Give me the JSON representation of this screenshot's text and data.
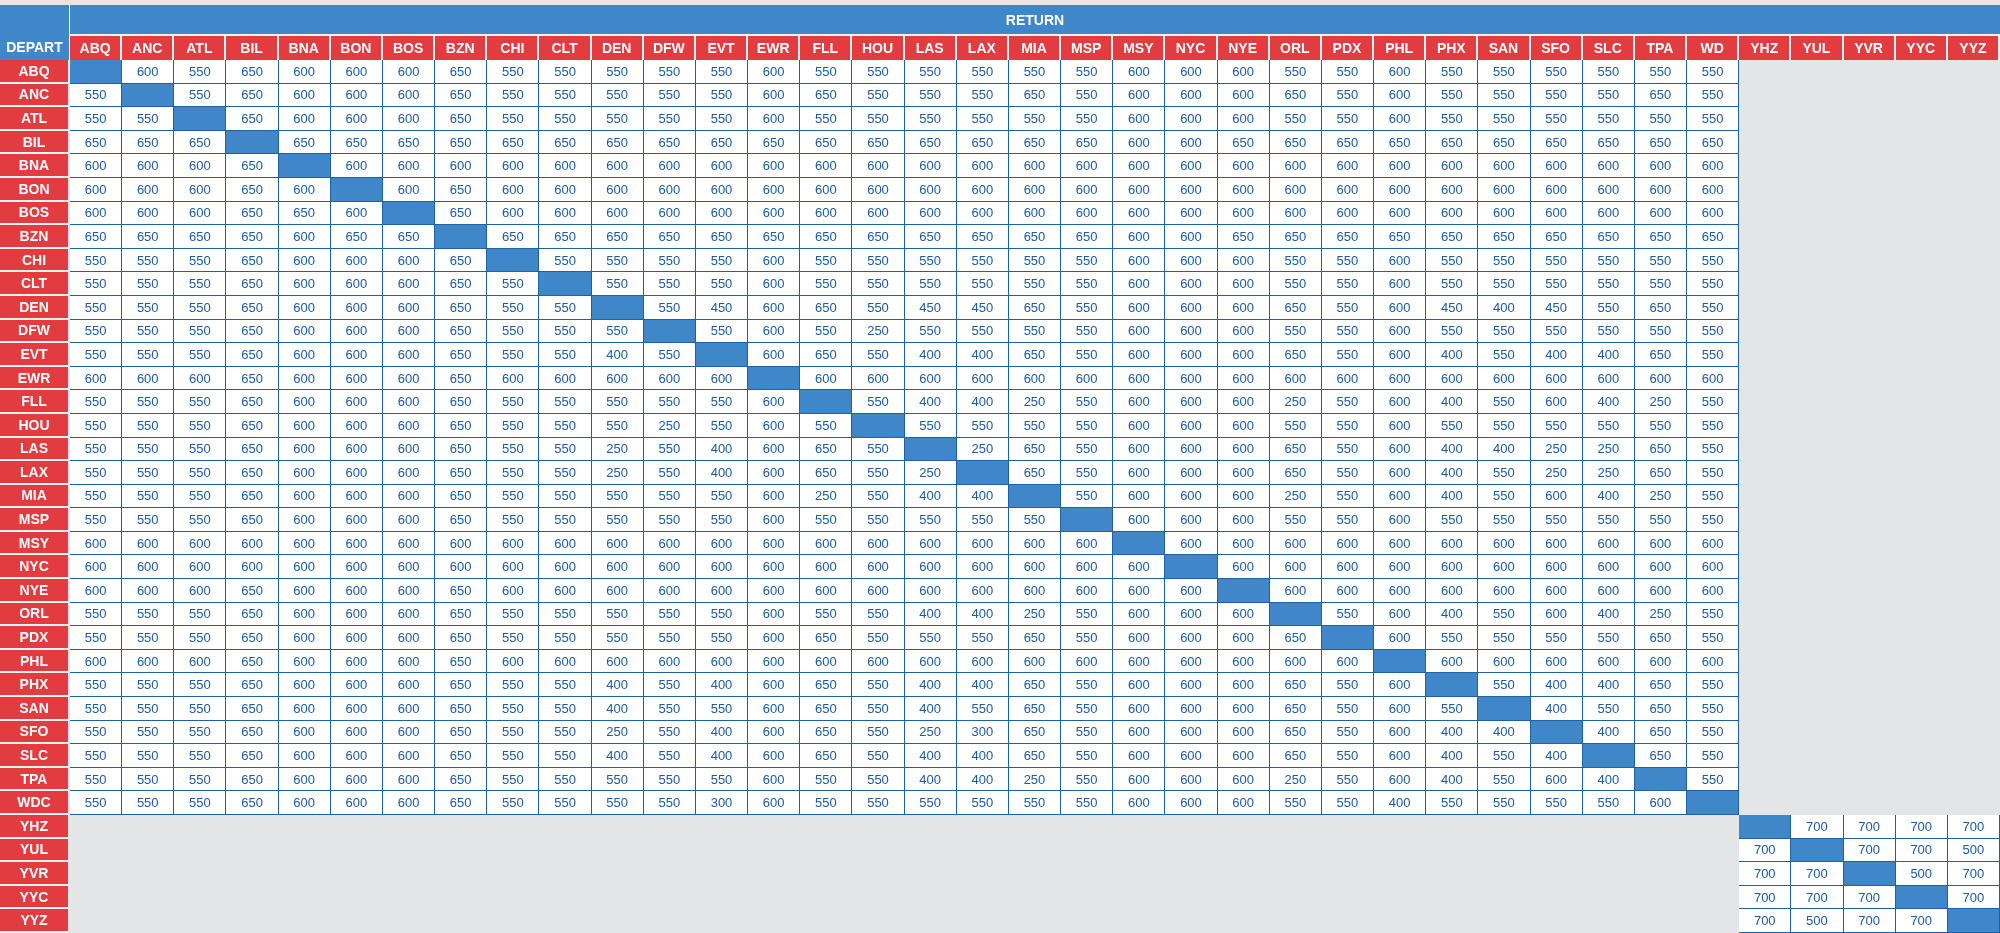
{
  "header": {
    "return_label": "RETURN",
    "depart_label": "DEPART"
  },
  "columns": [
    "ABQ",
    "ANC",
    "ATL",
    "BIL",
    "BNA",
    "BON",
    "BOS",
    "BZN",
    "CHI",
    "CLT",
    "DEN",
    "DFW",
    "EVT",
    "EWR",
    "FLL",
    "HOU",
    "LAS",
    "LAX",
    "MIA",
    "MSP",
    "MSY",
    "NYC",
    "NYE",
    "ORL",
    "PDX",
    "PHL",
    "PHX",
    "SAN",
    "SFO",
    "SLC",
    "TPA",
    "WD",
    "YHZ",
    "YUL",
    "YVR",
    "YYC",
    "YYZ"
  ],
  "rows": [
    {
      "code": "ABQ",
      "kind": "lead",
      "cells": [
        null,
        "600",
        "550",
        "650",
        "600",
        "600",
        "600",
        "650",
        "550",
        "550",
        "550",
        "550",
        "550",
        "600",
        "550",
        "550",
        "550",
        "550",
        "550",
        "550",
        "600",
        "600",
        "600",
        "550",
        "550",
        "600",
        "550",
        "550",
        "550",
        "550",
        "550",
        "550"
      ]
    },
    {
      "code": "ANC",
      "kind": "lead",
      "cells": [
        "550",
        null,
        "550",
        "650",
        "600",
        "600",
        "600",
        "650",
        "550",
        "550",
        "550",
        "550",
        "550",
        "600",
        "650",
        "550",
        "550",
        "550",
        "650",
        "550",
        "600",
        "600",
        "600",
        "650",
        "550",
        "600",
        "550",
        "550",
        "550",
        "550",
        "650",
        "550"
      ]
    },
    {
      "code": "ATL",
      "kind": "lead",
      "cells": [
        "550",
        "550",
        null,
        "650",
        "600",
        "600",
        "600",
        "650",
        "550",
        "550",
        "550",
        "550",
        "550",
        "600",
        "550",
        "550",
        "550",
        "550",
        "550",
        "550",
        "600",
        "600",
        "600",
        "550",
        "550",
        "600",
        "550",
        "550",
        "550",
        "550",
        "550",
        "550"
      ]
    },
    {
      "code": "BIL",
      "kind": "lead",
      "cells": [
        "650",
        "650",
        "650",
        null,
        "650",
        "650",
        "650",
        "650",
        "650",
        "650",
        "650",
        "650",
        "650",
        "650",
        "650",
        "650",
        "650",
        "650",
        "650",
        "650",
        "600",
        "600",
        "650",
        "650",
        "650",
        "650",
        "650",
        "650",
        "650",
        "650",
        "650",
        "650"
      ]
    },
    {
      "code": "BNA",
      "kind": "lead",
      "cells": [
        "600",
        "600",
        "600",
        "650",
        null,
        "600",
        "600",
        "600",
        "600",
        "600",
        "600",
        "600",
        "600",
        "600",
        "600",
        "600",
        "600",
        "600",
        "600",
        "600",
        "600",
        "600",
        "600",
        "600",
        "600",
        "600",
        "600",
        "600",
        "600",
        "600",
        "600",
        "600"
      ]
    },
    {
      "code": "BON",
      "kind": "lead",
      "cells": [
        "600",
        "600",
        "600",
        "650",
        "600",
        null,
        "600",
        "650",
        "600",
        "600",
        "600",
        "600",
        "600",
        "600",
        "600",
        "600",
        "600",
        "600",
        "600",
        "600",
        "600",
        "600",
        "600",
        "600",
        "600",
        "600",
        "600",
        "600",
        "600",
        "600",
        "600",
        "600"
      ]
    },
    {
      "code": "BOS",
      "kind": "lead",
      "cells": [
        "600",
        "600",
        "600",
        "650",
        "650",
        "600",
        null,
        "650",
        "600",
        "600",
        "600",
        "600",
        "600",
        "600",
        "600",
        "600",
        "600",
        "600",
        "600",
        "600",
        "600",
        "600",
        "600",
        "600",
        "600",
        "600",
        "600",
        "600",
        "600",
        "600",
        "600",
        "600"
      ]
    },
    {
      "code": "BZN",
      "kind": "lead",
      "cells": [
        "650",
        "650",
        "650",
        "650",
        "600",
        "650",
        "650",
        null,
        "650",
        "650",
        "650",
        "650",
        "650",
        "650",
        "650",
        "650",
        "650",
        "650",
        "650",
        "650",
        "600",
        "600",
        "650",
        "650",
        "650",
        "650",
        "650",
        "650",
        "650",
        "650",
        "650",
        "650"
      ]
    },
    {
      "code": "CHI",
      "kind": "lead",
      "cells": [
        "550",
        "550",
        "550",
        "650",
        "600",
        "600",
        "600",
        "650",
        null,
        "550",
        "550",
        "550",
        "550",
        "600",
        "550",
        "550",
        "550",
        "550",
        "550",
        "550",
        "600",
        "600",
        "600",
        "550",
        "550",
        "600",
        "550",
        "550",
        "550",
        "550",
        "550",
        "550"
      ]
    },
    {
      "code": "CLT",
      "kind": "lead",
      "cells": [
        "550",
        "550",
        "550",
        "650",
        "600",
        "600",
        "600",
        "650",
        "550",
        null,
        "550",
        "550",
        "550",
        "600",
        "550",
        "550",
        "550",
        "550",
        "550",
        "550",
        "600",
        "600",
        "600",
        "550",
        "550",
        "600",
        "550",
        "550",
        "550",
        "550",
        "550",
        "550"
      ]
    },
    {
      "code": "DEN",
      "kind": "lead",
      "cells": [
        "550",
        "550",
        "550",
        "650",
        "600",
        "600",
        "600",
        "650",
        "550",
        "550",
        null,
        "550",
        "450",
        "600",
        "650",
        "550",
        "450",
        "450",
        "650",
        "550",
        "600",
        "600",
        "600",
        "650",
        "550",
        "600",
        "450",
        "400",
        "450",
        "550",
        "650",
        "550"
      ]
    },
    {
      "code": "DFW",
      "kind": "lead",
      "cells": [
        "550",
        "550",
        "550",
        "650",
        "600",
        "600",
        "600",
        "650",
        "550",
        "550",
        "550",
        null,
        "550",
        "600",
        "550",
        "250",
        "550",
        "550",
        "550",
        "550",
        "600",
        "600",
        "600",
        "550",
        "550",
        "600",
        "550",
        "550",
        "550",
        "550",
        "550",
        "550"
      ]
    },
    {
      "code": "EVT",
      "kind": "lead",
      "cells": [
        "550",
        "550",
        "550",
        "650",
        "600",
        "600",
        "600",
        "650",
        "550",
        "550",
        "400",
        "550",
        null,
        "600",
        "650",
        "550",
        "400",
        "400",
        "650",
        "550",
        "600",
        "600",
        "600",
        "650",
        "550",
        "600",
        "400",
        "550",
        "400",
        "400",
        "650",
        "550"
      ]
    },
    {
      "code": "EWR",
      "kind": "lead",
      "cells": [
        "600",
        "600",
        "600",
        "650",
        "600",
        "600",
        "600",
        "650",
        "600",
        "600",
        "600",
        "600",
        "600",
        null,
        "600",
        "600",
        "600",
        "600",
        "600",
        "600",
        "600",
        "600",
        "600",
        "600",
        "600",
        "600",
        "600",
        "600",
        "600",
        "600",
        "600",
        "600"
      ]
    },
    {
      "code": "FLL",
      "kind": "lead",
      "cells": [
        "550",
        "550",
        "550",
        "650",
        "600",
        "600",
        "600",
        "650",
        "550",
        "550",
        "550",
        "550",
        "550",
        "600",
        null,
        "550",
        "400",
        "400",
        "250",
        "550",
        "600",
        "600",
        "600",
        "250",
        "550",
        "600",
        "400",
        "550",
        "600",
        "400",
        "250",
        "550"
      ]
    },
    {
      "code": "HOU",
      "kind": "lead",
      "cells": [
        "550",
        "550",
        "550",
        "650",
        "600",
        "600",
        "600",
        "650",
        "550",
        "550",
        "550",
        "250",
        "550",
        "600",
        "550",
        null,
        "550",
        "550",
        "550",
        "550",
        "600",
        "600",
        "600",
        "550",
        "550",
        "600",
        "550",
        "550",
        "550",
        "550",
        "550",
        "550"
      ]
    },
    {
      "code": "LAS",
      "kind": "lead",
      "cells": [
        "550",
        "550",
        "550",
        "650",
        "600",
        "600",
        "600",
        "650",
        "550",
        "550",
        "250",
        "550",
        "400",
        "600",
        "650",
        "550",
        null,
        "250",
        "650",
        "550",
        "600",
        "600",
        "600",
        "650",
        "550",
        "600",
        "400",
        "400",
        "250",
        "250",
        "650",
        "550"
      ]
    },
    {
      "code": "LAX",
      "kind": "lead",
      "cells": [
        "550",
        "550",
        "550",
        "650",
        "600",
        "600",
        "600",
        "650",
        "550",
        "550",
        "250",
        "550",
        "400",
        "600",
        "650",
        "550",
        "250",
        null,
        "650",
        "550",
        "600",
        "600",
        "600",
        "650",
        "550",
        "600",
        "400",
        "550",
        "250",
        "250",
        "650",
        "550"
      ]
    },
    {
      "code": "MIA",
      "kind": "lead",
      "cells": [
        "550",
        "550",
        "550",
        "650",
        "600",
        "600",
        "600",
        "650",
        "550",
        "550",
        "550",
        "550",
        "550",
        "600",
        "250",
        "550",
        "400",
        "400",
        null,
        "550",
        "600",
        "600",
        "600",
        "250",
        "550",
        "600",
        "400",
        "550",
        "600",
        "400",
        "250",
        "550"
      ]
    },
    {
      "code": "MSP",
      "kind": "lead",
      "cells": [
        "550",
        "550",
        "550",
        "650",
        "600",
        "600",
        "600",
        "650",
        "550",
        "550",
        "550",
        "550",
        "550",
        "600",
        "550",
        "550",
        "550",
        "550",
        "550",
        null,
        "600",
        "600",
        "600",
        "550",
        "550",
        "600",
        "550",
        "550",
        "550",
        "550",
        "550",
        "550"
      ]
    },
    {
      "code": "MSY",
      "kind": "lead",
      "cells": [
        "600",
        "600",
        "600",
        "600",
        "600",
        "600",
        "600",
        "600",
        "600",
        "600",
        "600",
        "600",
        "600",
        "600",
        "600",
        "600",
        "600",
        "600",
        "600",
        "600",
        null,
        "600",
        "600",
        "600",
        "600",
        "600",
        "600",
        "600",
        "600",
        "600",
        "600",
        "600"
      ]
    },
    {
      "code": "NYC",
      "kind": "lead",
      "cells": [
        "600",
        "600",
        "600",
        "600",
        "600",
        "600",
        "600",
        "600",
        "600",
        "600",
        "600",
        "600",
        "600",
        "600",
        "600",
        "600",
        "600",
        "600",
        "600",
        "600",
        "600",
        null,
        "600",
        "600",
        "600",
        "600",
        "600",
        "600",
        "600",
        "600",
        "600",
        "600"
      ]
    },
    {
      "code": "NYE",
      "kind": "lead",
      "cells": [
        "600",
        "600",
        "600",
        "650",
        "600",
        "600",
        "600",
        "650",
        "600",
        "600",
        "600",
        "600",
        "600",
        "600",
        "600",
        "600",
        "600",
        "600",
        "600",
        "600",
        "600",
        "600",
        null,
        "600",
        "600",
        "600",
        "600",
        "600",
        "600",
        "600",
        "600",
        "600"
      ]
    },
    {
      "code": "ORL",
      "kind": "lead",
      "cells": [
        "550",
        "550",
        "550",
        "650",
        "600",
        "600",
        "600",
        "650",
        "550",
        "550",
        "550",
        "550",
        "550",
        "600",
        "550",
        "550",
        "400",
        "400",
        "250",
        "550",
        "600",
        "600",
        "600",
        null,
        "550",
        "600",
        "400",
        "550",
        "600",
        "400",
        "250",
        "550"
      ]
    },
    {
      "code": "PDX",
      "kind": "lead",
      "cells": [
        "550",
        "550",
        "550",
        "650",
        "600",
        "600",
        "600",
        "650",
        "550",
        "550",
        "550",
        "550",
        "550",
        "600",
        "650",
        "550",
        "550",
        "550",
        "650",
        "550",
        "600",
        "600",
        "600",
        "650",
        null,
        "600",
        "550",
        "550",
        "550",
        "550",
        "650",
        "550"
      ]
    },
    {
      "code": "PHL",
      "kind": "lead",
      "cells": [
        "600",
        "600",
        "600",
        "650",
        "600",
        "600",
        "600",
        "650",
        "600",
        "600",
        "600",
        "600",
        "600",
        "600",
        "600",
        "600",
        "600",
        "600",
        "600",
        "600",
        "600",
        "600",
        "600",
        "600",
        "600",
        null,
        "600",
        "600",
        "600",
        "600",
        "600",
        "600"
      ]
    },
    {
      "code": "PHX",
      "kind": "lead",
      "cells": [
        "550",
        "550",
        "550",
        "650",
        "600",
        "600",
        "600",
        "650",
        "550",
        "550",
        "400",
        "550",
        "400",
        "600",
        "650",
        "550",
        "400",
        "400",
        "650",
        "550",
        "600",
        "600",
        "600",
        "650",
        "550",
        "600",
        null,
        "550",
        "400",
        "400",
        "650",
        "550"
      ]
    },
    {
      "code": "SAN",
      "kind": "lead",
      "cells": [
        "550",
        "550",
        "550",
        "650",
        "600",
        "600",
        "600",
        "650",
        "550",
        "550",
        "400",
        "550",
        "550",
        "600",
        "650",
        "550",
        "400",
        "550",
        "650",
        "550",
        "600",
        "600",
        "600",
        "650",
        "550",
        "600",
        "550",
        null,
        "400",
        "550",
        "650",
        "550"
      ]
    },
    {
      "code": "SFO",
      "kind": "lead",
      "cells": [
        "550",
        "550",
        "550",
        "650",
        "600",
        "600",
        "600",
        "650",
        "550",
        "550",
        "250",
        "550",
        "400",
        "600",
        "650",
        "550",
        "250",
        "300",
        "650",
        "550",
        "600",
        "600",
        "600",
        "650",
        "550",
        "600",
        "400",
        "400",
        null,
        "400",
        "650",
        "550"
      ]
    },
    {
      "code": "SLC",
      "kind": "lead",
      "cells": [
        "550",
        "550",
        "550",
        "650",
        "600",
        "600",
        "600",
        "650",
        "550",
        "550",
        "400",
        "550",
        "400",
        "600",
        "650",
        "550",
        "400",
        "400",
        "650",
        "550",
        "600",
        "600",
        "600",
        "650",
        "550",
        "600",
        "400",
        "550",
        "400",
        null,
        "650",
        "550"
      ]
    },
    {
      "code": "TPA",
      "kind": "lead",
      "cells": [
        "550",
        "550",
        "550",
        "650",
        "600",
        "600",
        "600",
        "650",
        "550",
        "550",
        "550",
        "550",
        "550",
        "600",
        "550",
        "550",
        "400",
        "400",
        "250",
        "550",
        "600",
        "600",
        "600",
        "250",
        "550",
        "600",
        "400",
        "550",
        "600",
        "400",
        null,
        "550"
      ]
    },
    {
      "code": "WDC",
      "kind": "lead",
      "cells": [
        "550",
        "550",
        "550",
        "650",
        "600",
        "600",
        "600",
        "650",
        "550",
        "550",
        "550",
        "550",
        "300",
        "600",
        "550",
        "550",
        "550",
        "550",
        "550",
        "550",
        "600",
        "600",
        "600",
        "550",
        "550",
        "400",
        "550",
        "550",
        "550",
        "550",
        "600",
        null
      ]
    },
    {
      "code": "YHZ",
      "kind": "trail",
      "cells": [
        null,
        "700",
        "700",
        "700",
        "700"
      ]
    },
    {
      "code": "YUL",
      "kind": "trail",
      "cells": [
        "700",
        null,
        "700",
        "700",
        "500"
      ]
    },
    {
      "code": "YVR",
      "kind": "trail",
      "cells": [
        "700",
        "700",
        null,
        "500",
        "700"
      ]
    },
    {
      "code": "YYC",
      "kind": "trail",
      "cells": [
        "700",
        "700",
        "700",
        null,
        "700"
      ]
    },
    {
      "code": "YYZ",
      "kind": "trail",
      "cells": [
        "700",
        "500",
        "700",
        "700",
        null
      ]
    }
  ]
}
